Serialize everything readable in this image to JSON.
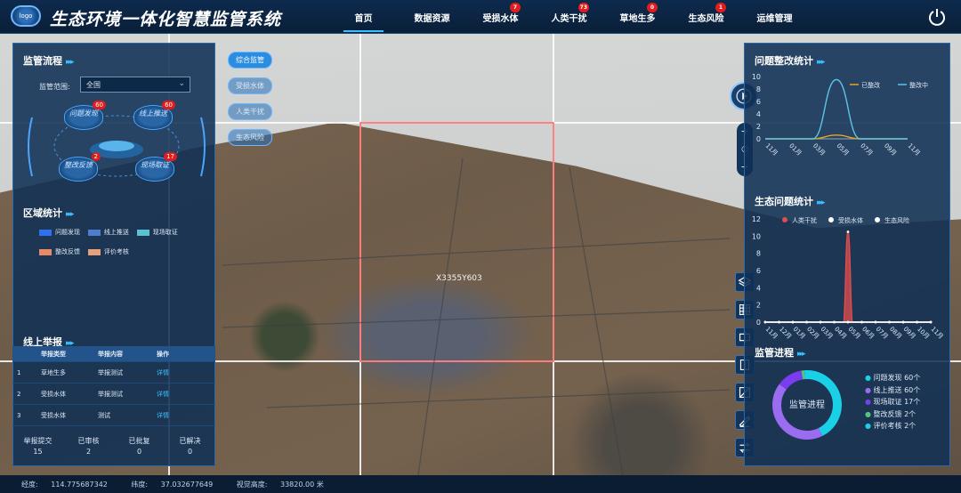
{
  "header": {
    "app_title": "生态环境一体化智慧监管系统",
    "logo_text": "logo",
    "nav": [
      {
        "label": "首页",
        "badge": ""
      },
      {
        "label": "数据资源",
        "badge": ""
      },
      {
        "label": "受损水体",
        "badge": "7"
      },
      {
        "label": "人类干扰",
        "badge": "73"
      },
      {
        "label": "草地生多",
        "badge": "0"
      },
      {
        "label": "生态风险",
        "badge": "1"
      },
      {
        "label": "运维管理",
        "badge": ""
      }
    ]
  },
  "left_panel": {
    "flow_title": "监管流程",
    "scope_label": "监管范围:",
    "scope_value": "全国",
    "flow_steps": [
      {
        "label": "问题发现",
        "count": "60"
      },
      {
        "label": "线上推送",
        "count": "60"
      },
      {
        "label": "整改反馈",
        "count": "2"
      },
      {
        "label": "现场取证",
        "count": "17"
      }
    ],
    "region_title": "区域统计",
    "region_legend": [
      {
        "label": "问题发现",
        "color": "#2f6ff0"
      },
      {
        "label": "线上推送",
        "color": "#4f7ccf"
      },
      {
        "label": "现场取证",
        "color": "#59c1cf"
      },
      {
        "label": "整改反馈",
        "color": "#e88a6a"
      },
      {
        "label": "评价考核",
        "color": "#e8a07a"
      }
    ],
    "report_title": "线上举报",
    "report_headers": [
      "",
      "举报类型",
      "举报内容",
      "操作"
    ],
    "report_rows": [
      {
        "no": "1",
        "type": "草地生多",
        "content": "举报测试",
        "action": "详情"
      },
      {
        "no": "2",
        "type": "受损水体",
        "content": "举报测试",
        "action": "详情"
      },
      {
        "no": "3",
        "type": "受损水体",
        "content": "测试",
        "action": "详情"
      }
    ],
    "totals": [
      {
        "label": "举报提交",
        "value": "15"
      },
      {
        "label": "已审核",
        "value": "2"
      },
      {
        "label": "已批复",
        "value": "0"
      },
      {
        "label": "已解决",
        "value": "0"
      }
    ]
  },
  "map": {
    "layers": [
      "综合监管",
      "受损水体",
      "人类干扰",
      "生态风险"
    ],
    "grid_label": "X3355Y603",
    "zoom_in": "+",
    "zoom_reset": "○",
    "zoom_out": "−"
  },
  "right_panel": {
    "rectify_title": "问题整改统计",
    "eco_title": "生态问题统计",
    "progress_title": "监管进程",
    "progress_center": "监管进程",
    "progress_items": [
      {
        "label": "问题发现",
        "value": "60个",
        "color": "#19d0e6"
      },
      {
        "label": "线上推送",
        "value": "60个",
        "color": "#9a6cf0"
      },
      {
        "label": "现场取证",
        "value": "17个",
        "color": "#7b3cf0"
      },
      {
        "label": "整改反馈",
        "value": "2个",
        "color": "#56c27a"
      },
      {
        "label": "评价考核",
        "value": "2个",
        "color": "#19d0e6"
      }
    ]
  },
  "chart_data": [
    {
      "type": "line",
      "title": "问题整改统计",
      "x": [
        "11月",
        "01月",
        "03月",
        "05月",
        "07月",
        "09月",
        "11月"
      ],
      "ylim": [
        0,
        10
      ],
      "yticks": [
        0,
        2,
        4,
        6,
        8,
        10
      ],
      "series": [
        {
          "name": "已整改",
          "color": "#e6a817",
          "values": [
            0,
            0,
            0,
            0.6,
            0,
            0,
            0
          ]
        },
        {
          "name": "整改中",
          "color": "#59c4e8",
          "values": [
            0,
            0,
            0,
            9.5,
            0,
            0,
            0
          ]
        }
      ],
      "legend": "top-right"
    },
    {
      "type": "area",
      "title": "生态问题统计",
      "x": [
        "11月",
        "12月",
        "01月",
        "02月",
        "03月",
        "04月",
        "05月",
        "06月",
        "07月",
        "08月",
        "09月",
        "10月",
        "11月"
      ],
      "ylim": [
        0,
        12
      ],
      "yticks": [
        0,
        2,
        4,
        6,
        8,
        10,
        12
      ],
      "series": [
        {
          "name": "人类干扰",
          "color": "#e24c4c",
          "values": [
            0,
            0,
            0,
            0,
            0,
            0,
            10.5,
            0,
            0,
            0,
            0,
            0,
            0
          ]
        },
        {
          "name": "受损水体",
          "color": "#ffffff",
          "values": [
            0,
            0,
            0,
            0,
            0,
            0,
            0,
            0,
            0,
            0,
            0,
            0,
            0
          ]
        },
        {
          "name": "生态风险",
          "color": "#ffffff",
          "values": [
            0,
            0,
            0,
            0,
            0,
            0,
            0,
            0,
            0,
            0,
            0,
            0,
            0
          ]
        }
      ],
      "legend": "top"
    },
    {
      "type": "pie",
      "title": "监管进程",
      "categories": [
        "问题发现",
        "线上推送",
        "现场取证",
        "整改反馈",
        "评价考核"
      ],
      "values": [
        60,
        60,
        17,
        2,
        2
      ]
    }
  ],
  "status": {
    "lon_label": "经度:",
    "lon": "114.775687342",
    "lat_label": "纬度:",
    "lat": "37.032677649",
    "alt_label": "视觉高度:",
    "alt": "33820.00 米"
  }
}
